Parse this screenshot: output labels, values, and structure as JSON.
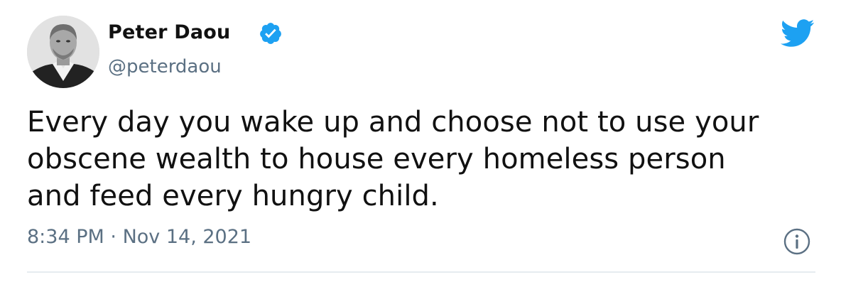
{
  "tweet": {
    "author": {
      "display_name": "Peter Daou",
      "handle": "@peterdaou",
      "verified_icon": "verified-badge-icon",
      "avatar_icon": "profile-photo"
    },
    "text": "Every day you wake up and choose not to use your\nobscene wealth to house every homeless person\nand feed every hungry child.",
    "time": "8:34 PM",
    "separator": "·",
    "date": "Nov 14, 2021",
    "brand_icon": "twitter-bird-icon",
    "info_icon": "info-icon"
  },
  "colors": {
    "brand_blue": "#1da1f2",
    "text_dark": "#111111",
    "text_muted": "#5b7083",
    "divider": "#e6ecf0"
  }
}
